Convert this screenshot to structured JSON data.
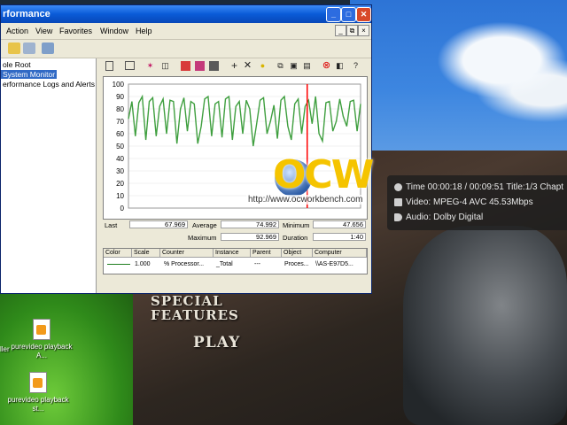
{
  "window": {
    "title": "rformance",
    "controls": {
      "minimize": "_",
      "maximize": "□",
      "close": "✕"
    }
  },
  "menubar": {
    "items": [
      "Action",
      "View",
      "Favorites",
      "Window",
      "Help"
    ],
    "mdi": [
      "_",
      "⧉",
      "×"
    ]
  },
  "tree": {
    "items": [
      "ole Root",
      "System Monitor",
      "erformance Logs and Alerts"
    ],
    "selected_index": 1
  },
  "graph": {
    "y_ticks": [
      "100",
      "90",
      "80",
      "70",
      "60",
      "50",
      "40",
      "30",
      "20",
      "10",
      "0"
    ],
    "line_color": "#3f9f3f",
    "marker_color": "#ff0000"
  },
  "chart_data": {
    "type": "line",
    "ylim": [
      0,
      100
    ],
    "series": [
      {
        "values": [
          72,
          86,
          58,
          85,
          90,
          55,
          86,
          89,
          58,
          82,
          88,
          60,
          87,
          86,
          52,
          80,
          89,
          62,
          86,
          84,
          52,
          66,
          88,
          90,
          58,
          84,
          86,
          57,
          88,
          90,
          55,
          82,
          86,
          60,
          87,
          80,
          50,
          68,
          87,
          89,
          60,
          70,
          83,
          56,
          87,
          90,
          66,
          55,
          84,
          88,
          60,
          82,
          87,
          68,
          90,
          60,
          54,
          85,
          86,
          62,
          70,
          88,
          74,
          66,
          86,
          87,
          62,
          84
        ]
      }
    ],
    "marker_fraction": 0.77
  },
  "stats": {
    "last_label": "Last",
    "last_value": "67.969",
    "average_label": "Average",
    "average_value": "74.992",
    "minimum_label": "Minimum",
    "minimum_value": "47.656",
    "maximum_label": "Maximum",
    "maximum_value": "92.969",
    "duration_label": "Duration",
    "duration_value": "1:40"
  },
  "legend": {
    "headers": [
      "Color",
      "Scale",
      "Counter",
      "Instance",
      "Parent",
      "Object",
      "Computer"
    ],
    "row": {
      "scale": "1.000",
      "counter": "% Processor...",
      "instance": "_Total",
      "parent": "---",
      "object": "Proces...",
      "computer": "\\\\AS-E97D5..."
    }
  },
  "watermark": {
    "logo": "OCW",
    "url": "http://www.ocworkbench.com"
  },
  "osd": {
    "time": "Time 00:00:18 / 00:09:51   Title:1/3   Chapt",
    "video": "Video: MPEG-4 AVC  45.53Mbps",
    "audio": "Audio: Dolby Digital"
  },
  "dvd_menu": {
    "special_features": "Special Features",
    "play": "Play"
  },
  "desktop": {
    "icons": [
      {
        "label": "purevideo playback A..."
      },
      {
        "label": "purevideo playback st..."
      }
    ],
    "partial_label": "ller"
  }
}
